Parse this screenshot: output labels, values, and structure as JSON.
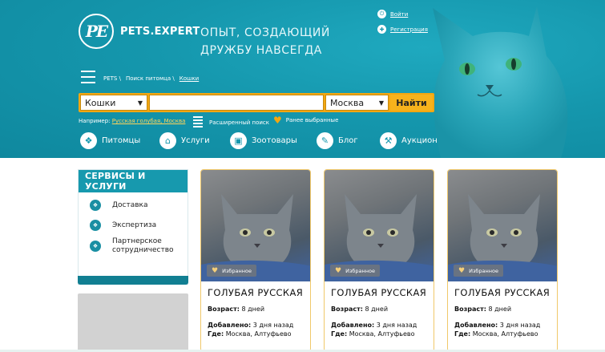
{
  "header": {
    "logo_text": "PE",
    "site_name": "PETS.EXPERT",
    "slogan_line1": "ОПЫТ, СОЗДАЮЩИЙ",
    "slogan_line2": "ДРУЖБУ НАВСЕГДА",
    "login": "Войти",
    "register": "Регистрация",
    "breadcrumbs": [
      "PETS \\",
      "Поиск питомца \\",
      "Кошки"
    ],
    "search": {
      "category": "Кошки",
      "query": "",
      "city": "Москва",
      "find_label": "Найти"
    },
    "example_label": "Например:",
    "example_link": "Русская голубая, Москва",
    "advanced_search": "Расширенный поиск",
    "favorites": "Ранее выбранные",
    "nav": [
      {
        "label": "Питомцы",
        "icon": "paw-icon"
      },
      {
        "label": "Услуги",
        "icon": "house-icon"
      },
      {
        "label": "Зоотовары",
        "icon": "bag-icon"
      },
      {
        "label": "Блог",
        "icon": "blog-icon"
      },
      {
        "label": "Аукцион",
        "icon": "gavel-icon"
      }
    ]
  },
  "sidebar": {
    "title": "СЕРВИСЫ И УСЛУГИ",
    "items": [
      {
        "label": "Доставка"
      },
      {
        "label": "Экспертиза"
      },
      {
        "label_line1": "Партнерское",
        "label_line2": "сотрудничество"
      }
    ]
  },
  "cards": [
    {
      "fav": "Избранное",
      "title": "ГОЛУБАЯ РУССКАЯ",
      "age_label": "Возраст:",
      "age": "8 дней",
      "added_label": "Добавлено:",
      "added": "3 дня назад",
      "where_label": "Где:",
      "where": "Москва, Алтуфьево"
    },
    {
      "fav": "Избранное",
      "title": "ГОЛУБАЯ РУССКАЯ",
      "age_label": "Возраст:",
      "age": "8 дней",
      "added_label": "Добавлено:",
      "added": "3 дня назад",
      "where_label": "Где:",
      "where": "Москва, Алтуфьево"
    },
    {
      "fav": "Избранное",
      "title": "ГОЛУБАЯ РУССКАЯ",
      "age_label": "Возраст:",
      "age": "8 дней",
      "added_label": "Добавлено:",
      "added": "3 дня назад",
      "where_label": "Где:",
      "where": "Москва, Алтуфьево"
    }
  ],
  "colors": {
    "teal": "#1597ad",
    "orange": "#f3a712",
    "link_yellow": "#ffd45a"
  }
}
